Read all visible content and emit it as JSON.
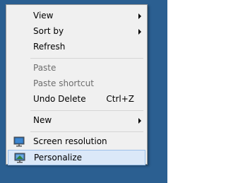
{
  "menu": {
    "items": [
      {
        "label": "View",
        "submenu": true,
        "disabled": false
      },
      {
        "label": "Sort by",
        "submenu": true,
        "disabled": false
      },
      {
        "label": "Refresh",
        "submenu": false,
        "disabled": false
      },
      {
        "label": "Paste",
        "submenu": false,
        "disabled": true
      },
      {
        "label": "Paste shortcut",
        "submenu": false,
        "disabled": true
      },
      {
        "label": "Undo Delete",
        "shortcut": "Ctrl+Z",
        "submenu": false,
        "disabled": false
      },
      {
        "label": "New",
        "submenu": true,
        "disabled": false
      },
      {
        "label": "Screen resolution",
        "icon": "screen-resolution-icon",
        "submenu": false,
        "disabled": false
      },
      {
        "label": "Personalize",
        "icon": "personalize-icon",
        "submenu": false,
        "disabled": false,
        "hovered": true
      }
    ]
  },
  "colors": {
    "desktop": "#2b5f91",
    "menu_bg": "#f0f0f0",
    "hover_bg": "#dbe8f8",
    "hover_border": "#9cc0e8",
    "disabled_text": "#6d6d6d"
  }
}
